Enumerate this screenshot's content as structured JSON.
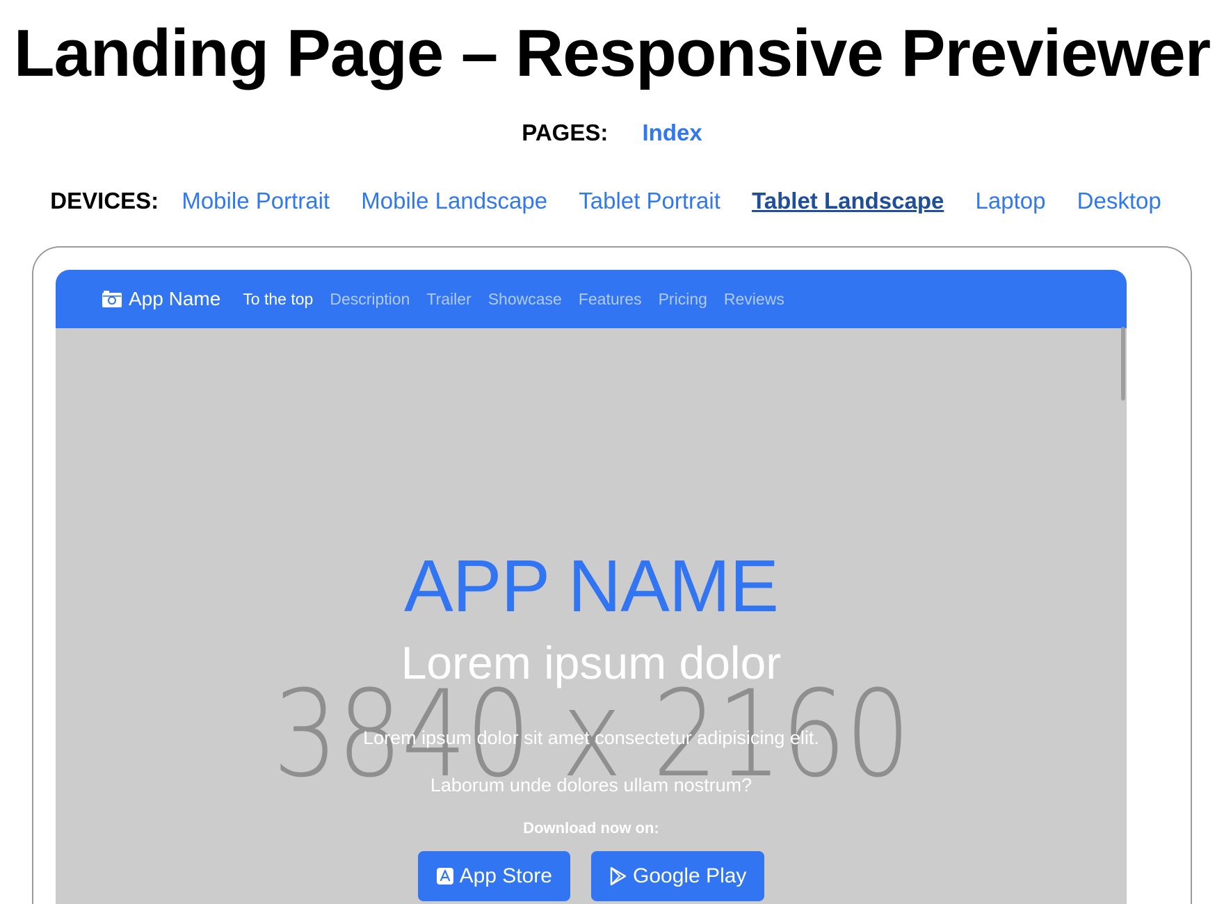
{
  "header": {
    "title": "Landing Page – Responsive Previewer"
  },
  "pages": {
    "label": "PAGES:",
    "items": [
      "Index"
    ]
  },
  "devices": {
    "label": "DEVICES:",
    "items": [
      "Mobile Portrait",
      "Mobile Landscape",
      "Tablet Portrait",
      "Tablet Landscape",
      "Laptop",
      "Desktop"
    ],
    "selected": "Tablet Landscape"
  },
  "preview": {
    "navbar": {
      "brand_label": "App Name",
      "brand_icon": "camera-icon",
      "links": [
        "To the top",
        "Description",
        "Trailer",
        "Showcase",
        "Features",
        "Pricing",
        "Reviews"
      ],
      "active_link": "To the top",
      "color": "#3175f3"
    },
    "hero": {
      "placeholder_text": "3840 x 2160",
      "app_name": "APP NAME",
      "subtitle": "Lorem ipsum dolor",
      "description_line1": "Lorem ipsum dolor sit amet consectetur adipisicing elit.",
      "description_line2": "Laborum unde dolores ullam nostrum?",
      "download_label": "Download now on:",
      "app_store_label": "App Store",
      "google_play_label": "Google Play",
      "background_color": "#cccccc"
    }
  },
  "colors": {
    "link": "#2f78f0",
    "link_active": "#1f4f9a",
    "accent": "#3175f3"
  }
}
